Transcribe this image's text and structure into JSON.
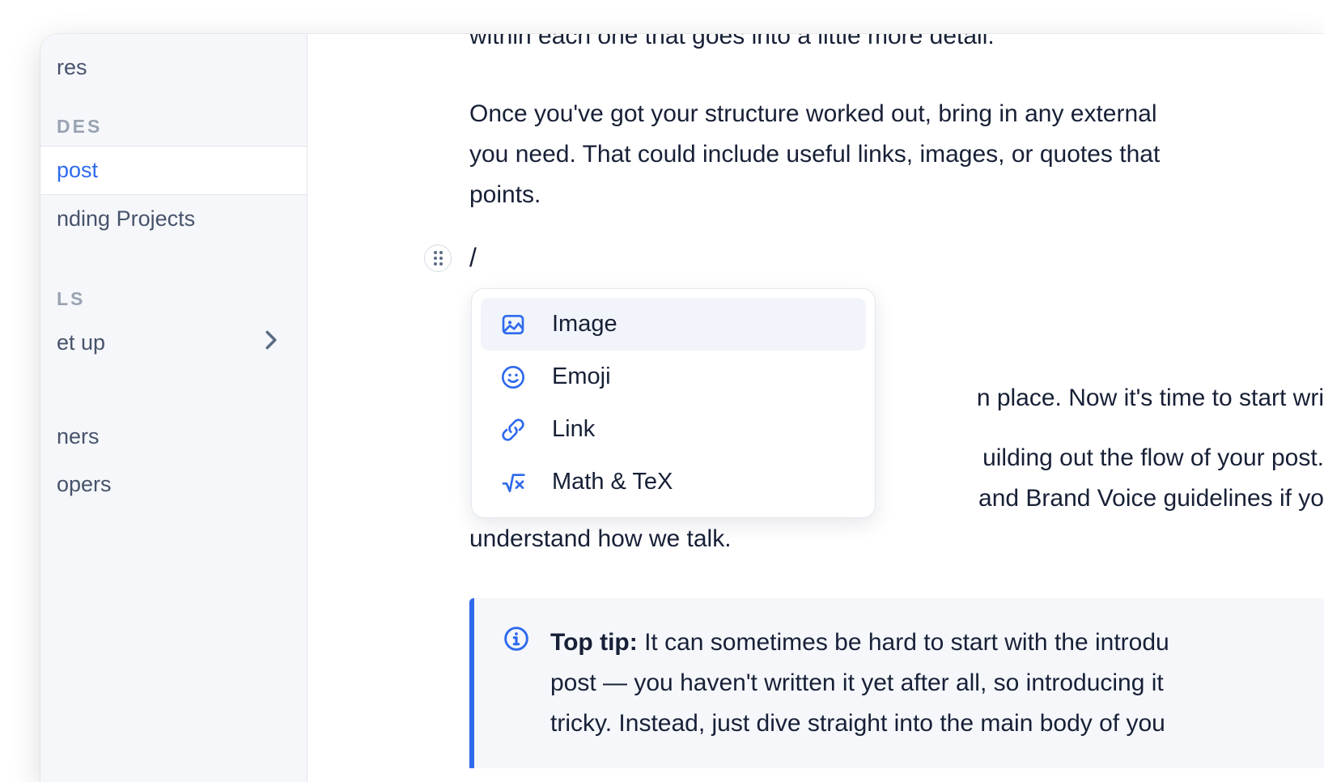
{
  "sidebar": {
    "item_top": "res",
    "section_guides": "DES",
    "item_post": "post",
    "item_projects": "nding Projects",
    "section_ls": "LS",
    "item_setup": "et up",
    "item_ners": "ners",
    "item_pers": "opers"
  },
  "content": {
    "p_cut": "within each one that goes into a little more detail.",
    "p1_line1": "Once you've got your structure worked out, bring in any external",
    "p1_line2": "you need. That could include useful links, images, or quotes that",
    "p1_line3": "points.",
    "slash": "/",
    "p2_line1": "n place. Now it's time to start wri",
    "p3_line1": "uilding out the flow of your post.",
    "p3_line2": " and Brand Voice guidelines if yo",
    "p3_line3": "understand how we talk."
  },
  "dropdown": {
    "items": [
      {
        "label": "Image",
        "icon": "image-icon"
      },
      {
        "label": "Emoji",
        "icon": "emoji-icon"
      },
      {
        "label": "Link",
        "icon": "link-icon"
      },
      {
        "label": "Math & TeX",
        "icon": "math-icon"
      }
    ]
  },
  "callout": {
    "title": "Top tip:",
    "line1": " It can sometimes be hard to start with the introdu",
    "line2": "post — you haven't written it yet after all, so introducing it",
    "line3": "tricky. Instead, just dive straight into the main body of you"
  }
}
